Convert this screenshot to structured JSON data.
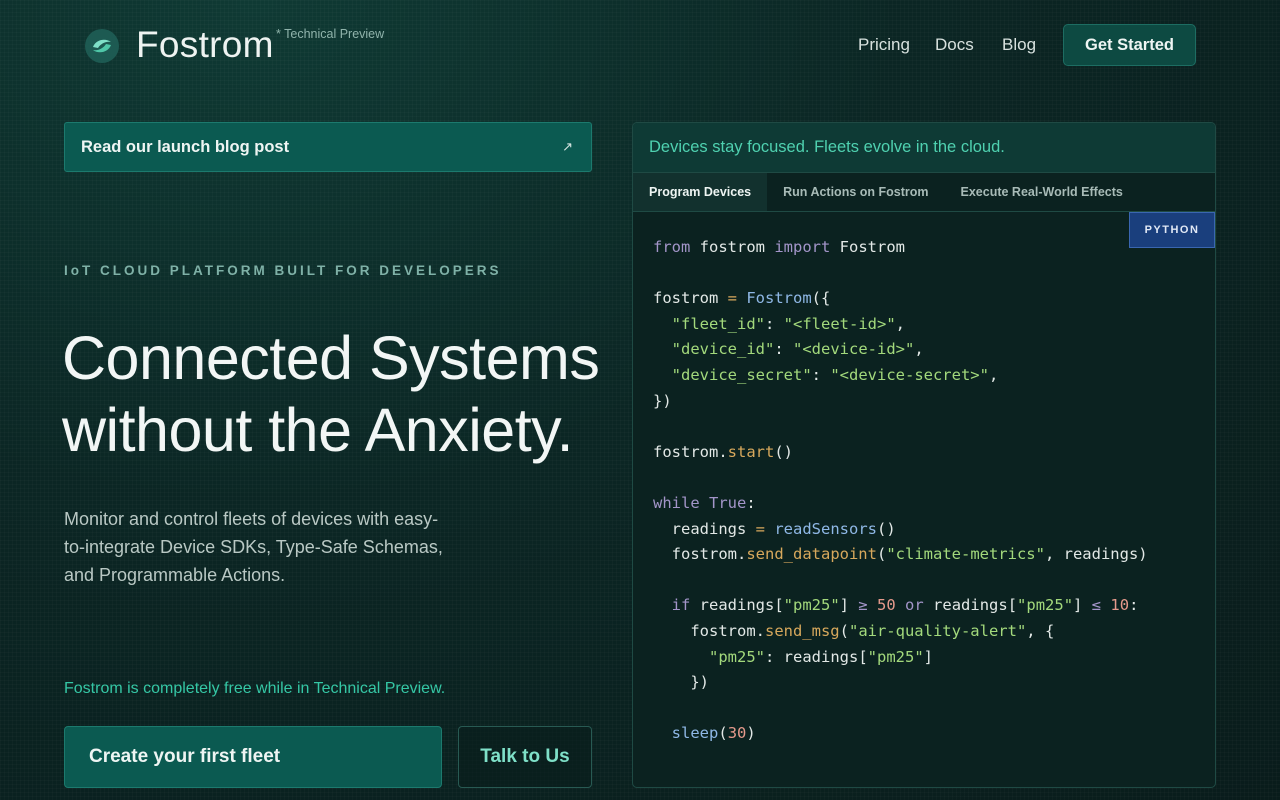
{
  "header": {
    "brand": "Fostrom",
    "preview_tag": "* Technical Preview",
    "nav": [
      "Pricing",
      "Docs",
      "Blog"
    ],
    "cta": "Get Started"
  },
  "hero": {
    "launch_link": "Read our launch blog post",
    "eyebrow": "IoT CLOUD PLATFORM BUILT FOR DEVELOPERS",
    "headline_1": "Connected Systems",
    "headline_2": "without the Anxiety.",
    "description": "Monitor and control fleets of devices with easy-to-integrate Device SDKs, Type-Safe Schemas, and Programmable Actions.",
    "free_note": "Fostrom is completely free while in Technical Preview.",
    "primary_button": "Create your first fleet",
    "secondary_button": "Talk to Us"
  },
  "panel": {
    "heading": "Devices stay focused. Fleets evolve in the cloud.",
    "tabs": [
      "Program Devices",
      "Run Actions on Fostrom",
      "Execute Real-World Effects"
    ],
    "active_tab": 0,
    "language": "PYTHON",
    "code": [
      [
        [
          "kw",
          "from"
        ],
        [
          "t",
          " fostrom "
        ],
        [
          "kw",
          "import"
        ],
        [
          "t",
          " Fostrom"
        ]
      ],
      [],
      [
        [
          "t",
          "fostrom "
        ],
        [
          "op",
          "="
        ],
        [
          "t",
          " "
        ],
        [
          "fn",
          "Fostrom"
        ],
        [
          "t",
          "({"
        ]
      ],
      [
        [
          "t",
          "  "
        ],
        [
          "str",
          "\"fleet_id\""
        ],
        [
          "t",
          ": "
        ],
        [
          "str",
          "\"<fleet-id>\""
        ],
        [
          "t",
          ","
        ]
      ],
      [
        [
          "t",
          "  "
        ],
        [
          "str",
          "\"device_id\""
        ],
        [
          "t",
          ": "
        ],
        [
          "str",
          "\"<device-id>\""
        ],
        [
          "t",
          ","
        ]
      ],
      [
        [
          "t",
          "  "
        ],
        [
          "str",
          "\"device_secret\""
        ],
        [
          "t",
          ": "
        ],
        [
          "str",
          "\"<device-secret>\""
        ],
        [
          "t",
          ","
        ]
      ],
      [
        [
          "t",
          "})"
        ]
      ],
      [],
      [
        [
          "t",
          "fostrom."
        ],
        [
          "op",
          "start"
        ],
        [
          "t",
          "()"
        ]
      ],
      [],
      [
        [
          "kw",
          "while"
        ],
        [
          "t",
          " "
        ],
        [
          "kw",
          "True"
        ],
        [
          "t",
          ":"
        ]
      ],
      [
        [
          "t",
          "  readings "
        ],
        [
          "op",
          "="
        ],
        [
          "t",
          " "
        ],
        [
          "fn",
          "readSensors"
        ],
        [
          "t",
          "()"
        ]
      ],
      [
        [
          "t",
          "  fostrom."
        ],
        [
          "op",
          "send_datapoint"
        ],
        [
          "t",
          "("
        ],
        [
          "str",
          "\"climate-metrics\""
        ],
        [
          "t",
          ", readings)"
        ]
      ],
      [],
      [
        [
          "t",
          "  "
        ],
        [
          "kw",
          "if"
        ],
        [
          "t",
          " readings["
        ],
        [
          "str",
          "\"pm25\""
        ],
        [
          "t",
          "] "
        ],
        [
          "kw",
          "≥"
        ],
        [
          "t",
          " "
        ],
        [
          "num",
          "50"
        ],
        [
          "t",
          " "
        ],
        [
          "kw",
          "or"
        ],
        [
          "t",
          " readings["
        ],
        [
          "str",
          "\"pm25\""
        ],
        [
          "t",
          "] "
        ],
        [
          "kw",
          "≤"
        ],
        [
          "t",
          " "
        ],
        [
          "num",
          "10"
        ],
        [
          "t",
          ":"
        ]
      ],
      [
        [
          "t",
          "    fostrom."
        ],
        [
          "op",
          "send_msg"
        ],
        [
          "t",
          "("
        ],
        [
          "str",
          "\"air-quality-alert\""
        ],
        [
          "t",
          ", {"
        ]
      ],
      [
        [
          "t",
          "      "
        ],
        [
          "str",
          "\"pm25\""
        ],
        [
          "t",
          ": readings["
        ],
        [
          "str",
          "\"pm25\""
        ],
        [
          "t",
          "]"
        ]
      ],
      [
        [
          "t",
          "    })"
        ]
      ],
      [],
      [
        [
          "t",
          "  "
        ],
        [
          "fn",
          "sleep"
        ],
        [
          "t",
          "("
        ],
        [
          "num",
          "30"
        ],
        [
          "t",
          ")"
        ]
      ]
    ]
  }
}
